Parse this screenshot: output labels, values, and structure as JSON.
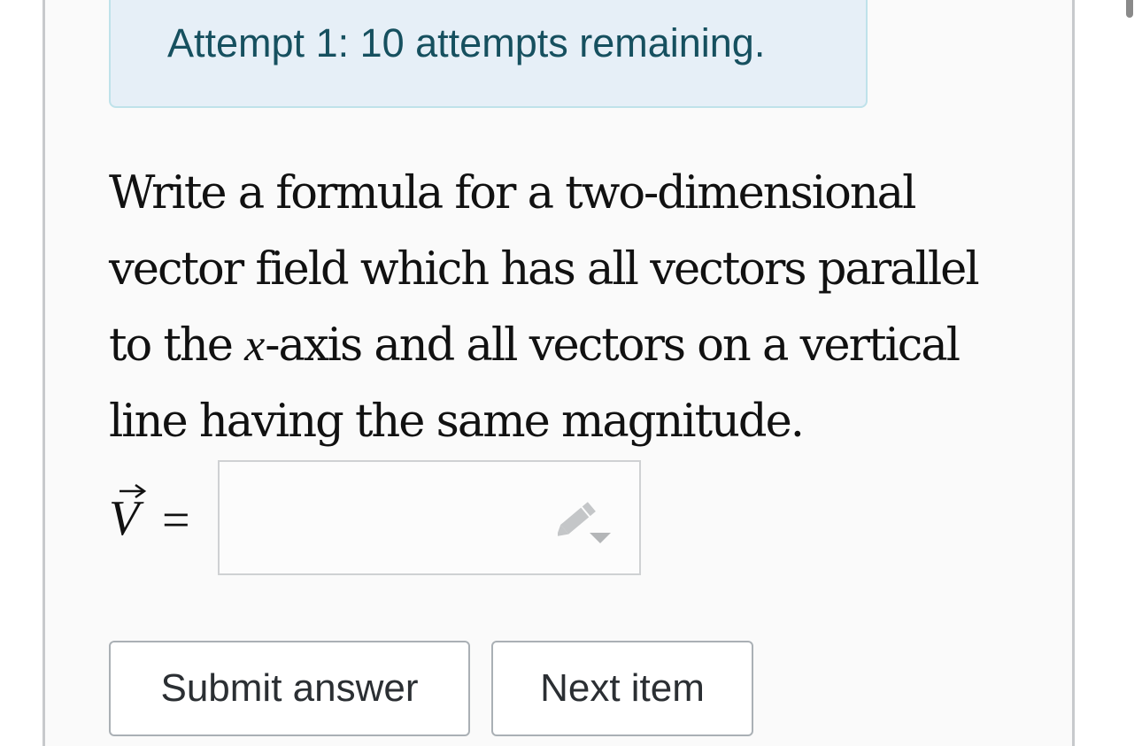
{
  "attempt_banner": {
    "text": "Attempt 1: 10 attempts remaining."
  },
  "question": {
    "part1": "Write a formula for a two-dimensional vector field which has all vectors parallel to the ",
    "math_var": "x",
    "part2": "-axis and all vectors on a vertical line having the same magnitude."
  },
  "answer": {
    "vector_symbol": "V",
    "equals": "=",
    "value": "",
    "input_icon": "pencil-dropdown-icon"
  },
  "buttons": {
    "submit_label": "Submit answer",
    "next_label": "Next item"
  },
  "colors": {
    "banner_bg": "#e6eff7",
    "banner_border": "#bfe2ea",
    "banner_text": "#16505f",
    "button_border": "#aab0b5"
  }
}
